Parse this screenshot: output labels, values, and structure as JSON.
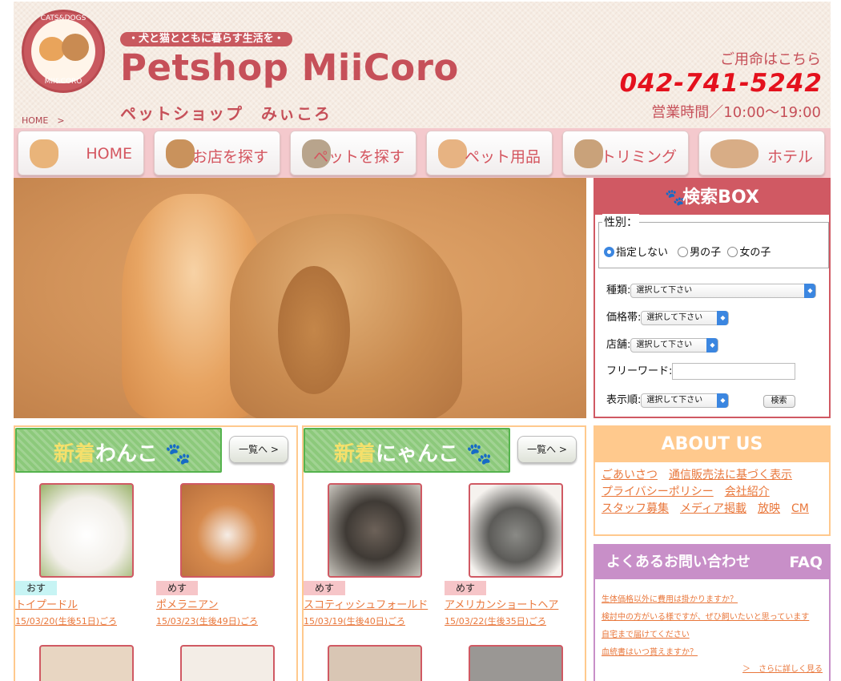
{
  "header": {
    "logo_top": "CATS&DOGS",
    "logo_bottom": "MII&CORO",
    "tagline": "・犬と猫とともに暮らす生活を・",
    "brand": "Petshop MiiCoro",
    "brand_kana": "ペットショップ　みぃころ",
    "breadcrumb": "HOME　>",
    "contact_label": "ご用命はこちら",
    "phone": "042-741-5242",
    "hours": "営業時間／10:00〜19:00"
  },
  "nav": [
    {
      "label": "HOME",
      "icon": "cat-icon"
    },
    {
      "label": "お店を探す",
      "icon": "dog-icon"
    },
    {
      "label": "ペットを探す",
      "icon": "cat-icon"
    },
    {
      "label": "ペット用品",
      "icon": "cat-icon"
    },
    {
      "label": "トリミング",
      "icon": "cat-icon"
    },
    {
      "label": "ホテル",
      "icon": "dog-icon"
    }
  ],
  "search": {
    "title": "検索BOX",
    "sex_legend": "性別：",
    "sex_options": [
      "指定しない",
      "男の子",
      "女の子"
    ],
    "sex_selected": "指定しない",
    "kind_label": "種類:",
    "price_label": "価格帯:",
    "store_label": "店舗:",
    "freeword_label": "フリーワード:",
    "freeword_value": "",
    "order_label": "表示順:",
    "select_placeholder": "選択して下さい",
    "submit_label": "検索"
  },
  "dogs": {
    "title_new": "新着",
    "title_rest": "わんこ",
    "more_label": "一覧へ >",
    "items": [
      {
        "sex": "おす",
        "breed": "トイプードル",
        "date": "15/03/20(生後51日)ごろ"
      },
      {
        "sex": "めす",
        "breed": "ポメラニアン",
        "date": "15/03/23(生後49日)ごろ"
      }
    ]
  },
  "cats": {
    "title_new": "新着",
    "title_rest": "にゃんこ",
    "more_label": "一覧へ >",
    "items": [
      {
        "sex": "めす",
        "breed": "スコティッシュフォールド",
        "date": "15/03/19(生後40日)ごろ"
      },
      {
        "sex": "めす",
        "breed": "アメリカンショートヘア",
        "date": "15/03/22(生後35日)ごろ"
      }
    ]
  },
  "about": {
    "title": "ABOUT US",
    "links": [
      "ごあいさつ",
      "通信販売法に基づく表示",
      "プライバシーポリシー",
      "会社紹介",
      "スタッフ募集",
      "メディア掲載",
      "放映",
      "CM"
    ]
  },
  "faq": {
    "title": "よくあるお問い合わせ",
    "title_en": "FAQ",
    "items": [
      "生体価格以外に費用は掛かりますか？",
      "検討中の方がいる様ですが、ぜひ飼いたいと思っています",
      "自宅まで届けてください",
      "血統書はいつ貰えますか？"
    ],
    "more": "＞　さらに詳しく見る"
  },
  "colors": {
    "accent": "#d05963",
    "phone": "#e4111d",
    "link": "#e9773b",
    "green": "#8cc97b",
    "male_badge": "#c7f4f4",
    "female_badge": "#f6c5c8"
  }
}
